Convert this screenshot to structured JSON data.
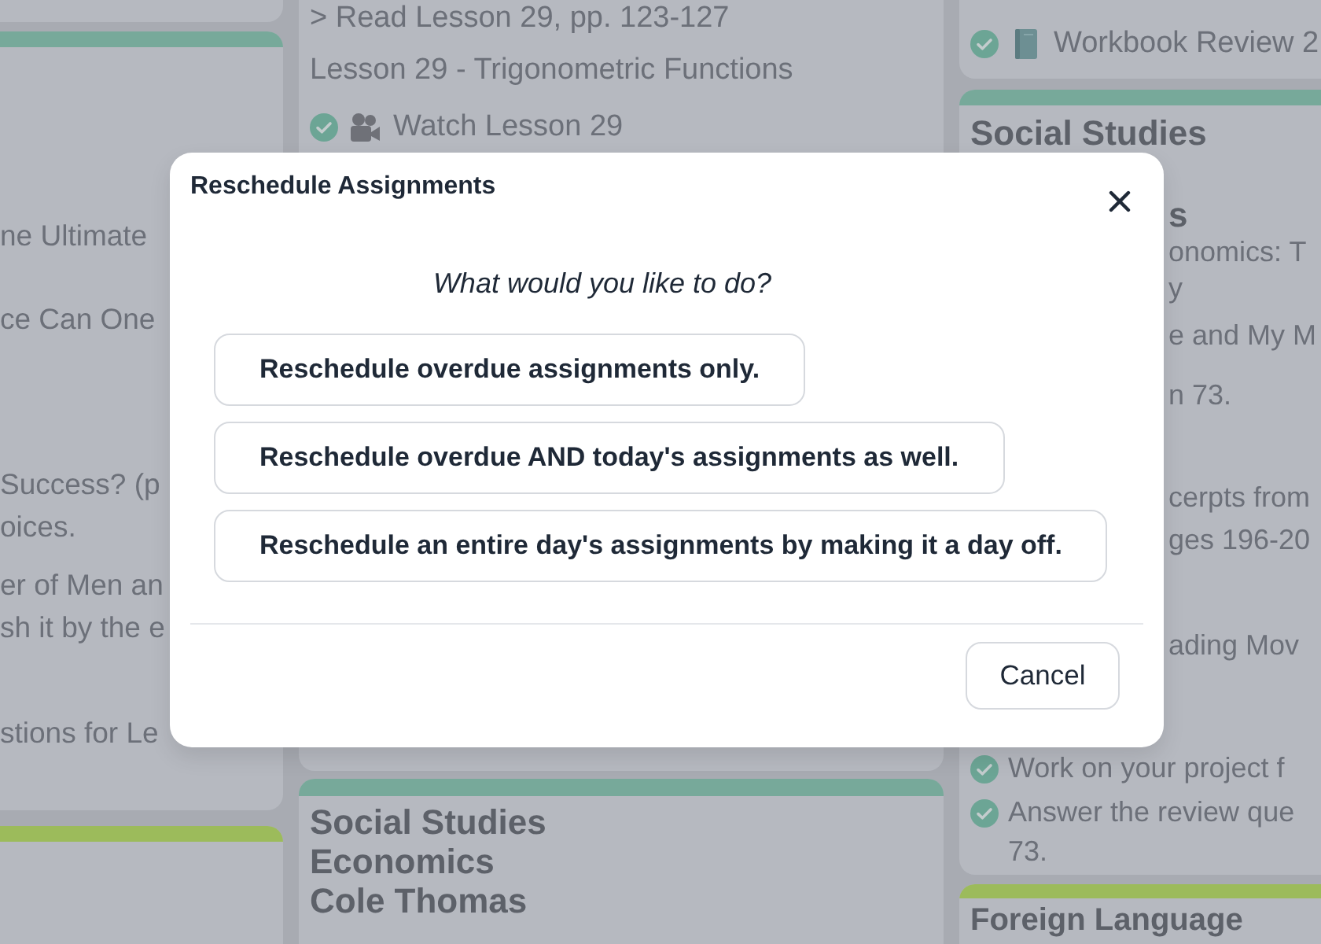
{
  "planner": {
    "left_column": {
      "notes_card": {
        "color": "#77a99a",
        "notes": [
          {
            "lines": [
              "ne Ultimate"
            ]
          },
          {
            "lines": [
              "ce Can One"
            ]
          },
          {
            "lines": [
              "Success? (p",
              "oices."
            ]
          },
          {
            "lines": [
              "er of Men an",
              "sh it by the e"
            ]
          },
          {
            "lines": [
              "stions for Le"
            ]
          }
        ]
      },
      "next_card": {
        "color": "#9cbb5b"
      }
    },
    "middle_column": {
      "top_card": {
        "lines": [
          "> Read Lesson 29, pp. 123-127",
          "Lesson 29 - Trigonometric Functions"
        ],
        "tasks": [
          {
            "kind": "video",
            "lines": [
              "Watch Lesson 29"
            ],
            "checked": true
          }
        ]
      },
      "next_card": {
        "color": "#77a99a",
        "title_lines": [
          "Social Studies",
          "Economics",
          "Cole Thomas"
        ]
      }
    },
    "right_column": {
      "top_card": {
        "tasks": [
          {
            "kind": "book",
            "lines": [
              "Workbook Review 2"
            ],
            "checked": true
          }
        ]
      },
      "subject_card": {
        "color": "#77a99a",
        "title_lines": [
          "Social Studies"
        ],
        "title_fragment": "s",
        "notes": [
          "onomics: T",
          "y",
          "e and My M",
          "n 73.",
          "cerpts from",
          "ges 196-20",
          "ading Mov"
        ],
        "tasks": [
          {
            "lines": [
              "Work on your project f"
            ],
            "checked": true
          },
          {
            "lines": [
              "Answer the review que",
              "73."
            ],
            "checked": true
          }
        ]
      },
      "next_card": {
        "color": "#9cbb5b",
        "title_lines": [
          "Foreign Language"
        ]
      }
    }
  },
  "dialog": {
    "title": "Reschedule Assignments",
    "prompt": "What would you like to do?",
    "options": [
      "Reschedule overdue assignments only.",
      "Reschedule overdue AND today's assignments as well.",
      "Reschedule an entire day's assignments by making it a day off."
    ],
    "cancel": "Cancel"
  }
}
